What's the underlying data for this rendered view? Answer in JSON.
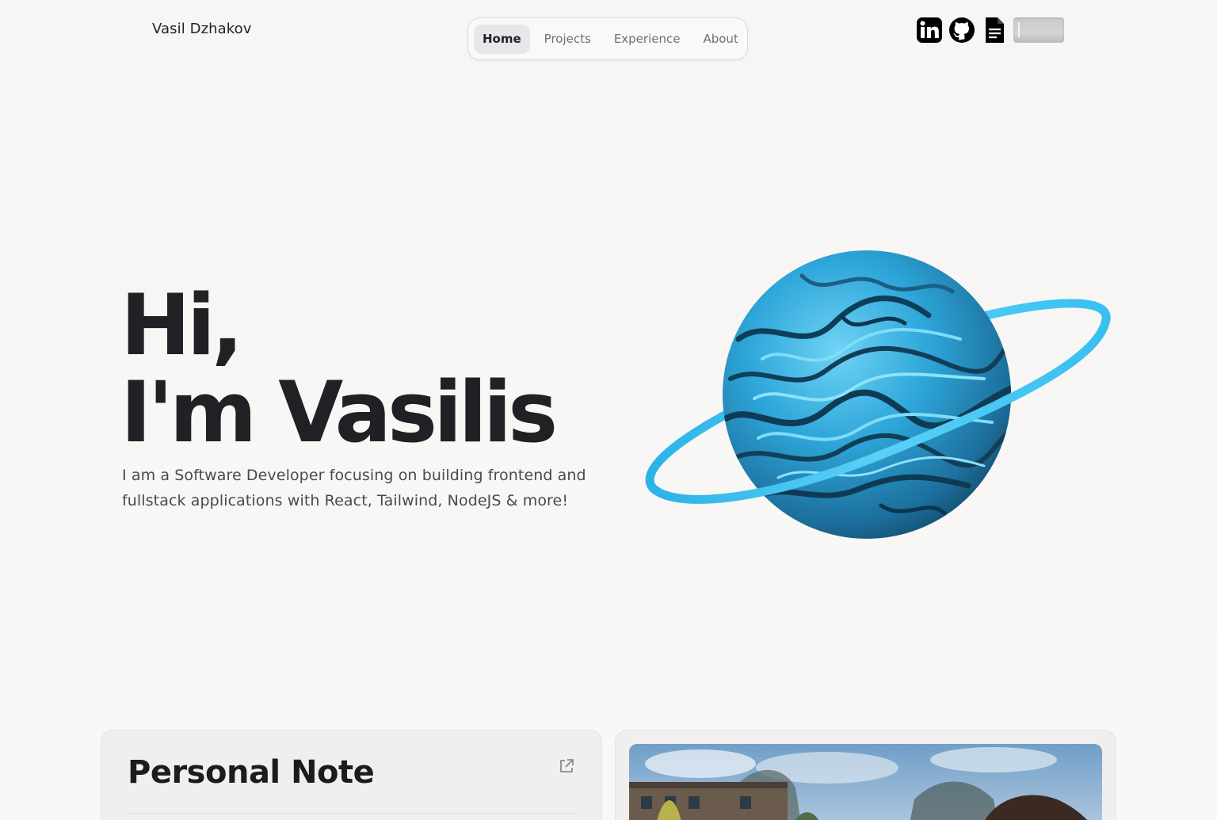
{
  "header": {
    "brand": "Vasil Dzhakov",
    "nav": [
      {
        "label": "Home",
        "active": true
      },
      {
        "label": "Projects",
        "active": false
      },
      {
        "label": "Experience",
        "active": false
      },
      {
        "label": "About",
        "active": false
      }
    ],
    "socials": [
      "linkedin-icon",
      "github-icon",
      "resume-document-icon"
    ],
    "theme_toggle": "off"
  },
  "hero": {
    "line1": "Hi,",
    "line2": "I'm Vasilis",
    "subtitle": "I am a Software Developer focusing on building frontend and fullstack applications with React, Tailwind, NodeJS & more!"
  },
  "cards": {
    "note_title": "Personal Note"
  },
  "colors": {
    "background": "#f7f6f5",
    "planet_accent": "#2fb7ea",
    "nav_active_bg": "#e5e7eb"
  }
}
